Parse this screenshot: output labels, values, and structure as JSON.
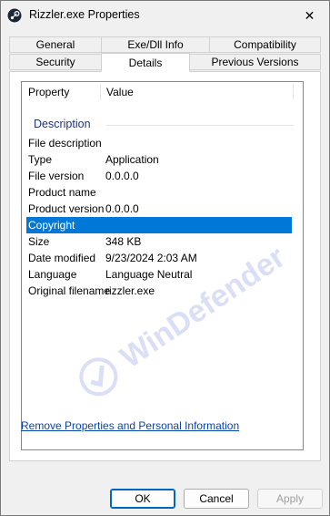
{
  "window": {
    "title": "Rizzler.exe Properties",
    "icon": "steam-icon",
    "close_glyph": "✕"
  },
  "tabs": {
    "row1": [
      "General",
      "Exe/Dll Info",
      "Compatibility"
    ],
    "row2": [
      "Security",
      "Details",
      "Previous Versions"
    ],
    "active": "Details"
  },
  "details": {
    "headers": {
      "property": "Property",
      "value": "Value"
    },
    "group_label": "Description",
    "rows": [
      {
        "k": "File description",
        "v": ""
      },
      {
        "k": "Type",
        "v": "Application"
      },
      {
        "k": "File version",
        "v": "0.0.0.0"
      },
      {
        "k": "Product name",
        "v": ""
      },
      {
        "k": "Product version",
        "v": "0.0.0.0"
      },
      {
        "k": "Copyright",
        "v": "",
        "selected": true
      },
      {
        "k": "Size",
        "v": "348 KB"
      },
      {
        "k": "Date modified",
        "v": "9/23/2024 2:03 AM"
      },
      {
        "k": "Language",
        "v": "Language Neutral"
      },
      {
        "k": "Original filename",
        "v": "rizzler.exe"
      }
    ],
    "selected_color": "#0078d7"
  },
  "watermark": {
    "text": "WinDefender"
  },
  "links": {
    "remove": "Remove Properties and Personal Information"
  },
  "buttons": {
    "ok": "OK",
    "cancel": "Cancel",
    "apply": "Apply"
  }
}
